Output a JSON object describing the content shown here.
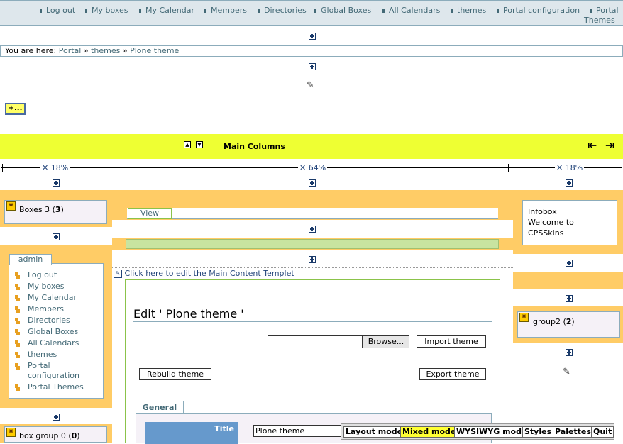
{
  "topnav": {
    "items": [
      "Log out",
      "My boxes",
      "My Calendar",
      "Members",
      "Directories",
      "Global Boxes",
      "All Calendars",
      "themes",
      "Portal configuration",
      "Portal",
      "Themes"
    ]
  },
  "breadcrumb": {
    "prefix": "You are here:",
    "items": [
      "Portal",
      "themes",
      "Plone theme"
    ],
    "sep": "»"
  },
  "add_button": {
    "label": "+..."
  },
  "main_columns": {
    "title": "Main Columns"
  },
  "ruler": {
    "left": "18%",
    "center": "64%",
    "right": "18%"
  },
  "left": {
    "boxes3": {
      "label": "Boxes 3",
      "count": "3"
    },
    "admin": {
      "tab": "admin",
      "items": [
        "Log out",
        "My boxes",
        "My Calendar",
        "Members",
        "Directories",
        "Global Boxes",
        "All Calendars",
        "themes",
        "Portal",
        "configuration",
        "Portal Themes"
      ]
    },
    "boxgroup0": {
      "label": "box group 0",
      "count": "0"
    }
  },
  "center": {
    "view_tab": "View",
    "edit_templet_link": "Click here to edit the Main Content Templet",
    "heading": "Edit ' Plone theme '",
    "browse_label": "Browse...",
    "import_label": "Import theme",
    "rebuild_label": "Rebuild theme",
    "export_label": "Export theme",
    "general_tab": "General",
    "title_label": "Title",
    "title_value": "Plone theme"
  },
  "right": {
    "infobox": {
      "l1": "Infobox",
      "l2": "Welcome to",
      "l3": "CPSSkins"
    },
    "group2": {
      "label": "group2",
      "count": "2"
    }
  },
  "toolbar": {
    "layout": "Layout mode",
    "mixed": "Mixed mode",
    "wysiwyg": "WYSIWYG mode",
    "styles": "Styles",
    "palettes": "Palettes",
    "quit": "Quit"
  },
  "colors": {
    "accent_yellow": "#eeff33",
    "orange": "#ffcc66",
    "nav_bg": "#dee7ec",
    "table_header": "#6699cc"
  }
}
